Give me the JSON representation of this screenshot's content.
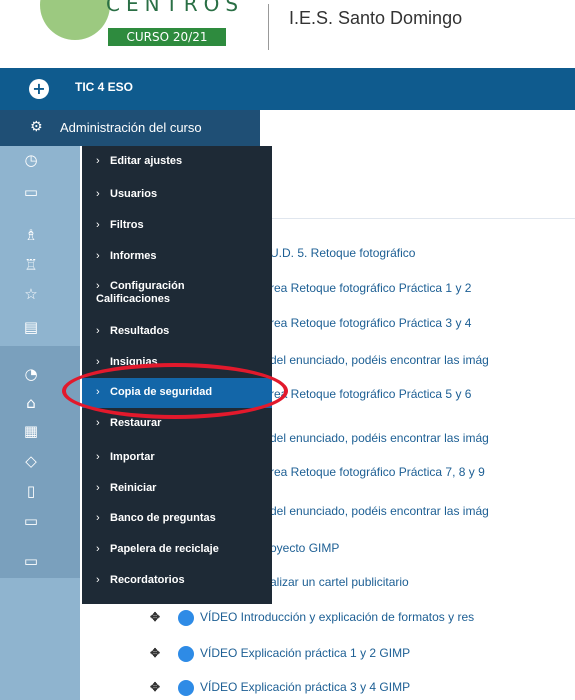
{
  "header": {
    "logo_word": "CENTROS",
    "logo_badge": "CURSO 20/21",
    "school": "I.E.S. Santo Domingo"
  },
  "navbar": {
    "course": "TIC 4 ESO"
  },
  "admin": {
    "label": "Administración del curso"
  },
  "menu": {
    "items": [
      "Editar ajustes",
      "Usuarios",
      "Filtros",
      "Informes",
      "Configuración Calificaciones",
      "Resultados",
      "Insignias",
      "Copia de seguridad",
      "Restaurar",
      "Importar",
      "Reiniciar",
      "Banco de preguntas",
      "Papelera de reciclaje",
      "Recordatorios"
    ]
  },
  "content": {
    "lines": [
      "U.D. 5. Retoque fotográfico",
      "rea Retoque fotográfico Práctica 1 y 2",
      "rea Retoque fotográfico Práctica 3 y 4",
      "del enunciado, podéis encontrar las imág",
      "rea Retoque fotográfico Práctica 5 y 6",
      "del enunciado, podéis encontrar las imág",
      "rea Retoque fotográfico Práctica 7, 8 y 9",
      "del enunciado, podéis encontrar las imág",
      "oyecto GIMP",
      "alizar un cartel publicitario"
    ],
    "videos": [
      "VÍDEO Introducción y explicación de formatos y res",
      "VÍDEO Explicación práctica 1 y 2 GIMP",
      "VÍDEO Explicación práctica 3 y 4 GIMP"
    ]
  }
}
